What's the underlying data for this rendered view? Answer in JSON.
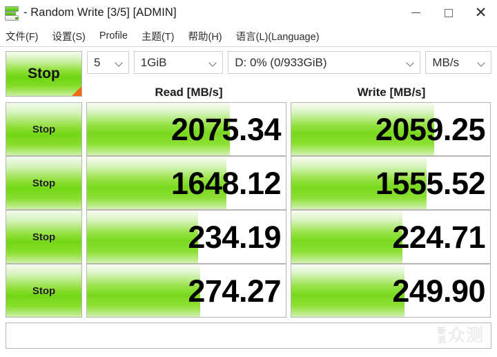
{
  "window": {
    "title": "- Random Write [3/5] [ADMIN]",
    "app_icon": "crystaldiskmark-icon",
    "minimize_label": "Minimize",
    "maximize_label": "Maximize",
    "close_label": "Close"
  },
  "menubar": {
    "items": [
      {
        "label": "文件(F)",
        "name": "menu-file"
      },
      {
        "label": "设置(S)",
        "name": "menu-settings"
      },
      {
        "label": "Profile",
        "name": "menu-profile"
      },
      {
        "label": "主题(T)",
        "name": "menu-theme"
      },
      {
        "label": "帮助(H)",
        "name": "menu-help"
      },
      {
        "label": "语言(L)(Language)",
        "name": "menu-language"
      }
    ]
  },
  "toolbar": {
    "all_button_label": "Stop",
    "test_count": "5",
    "test_size": "1GiB",
    "drive": "D: 0% (0/933GiB)",
    "unit": "MB/s"
  },
  "headers": {
    "read": "Read [MB/s]",
    "write": "Write [MB/s]"
  },
  "rows": [
    {
      "button_label": "Stop",
      "read": "2075.34",
      "write": "2059.25",
      "read_fill_pct": 72,
      "write_fill_pct": 72
    },
    {
      "button_label": "Stop",
      "read": "1648.12",
      "write": "1555.52",
      "read_fill_pct": 70,
      "write_fill_pct": 68
    },
    {
      "button_label": "Stop",
      "read": "234.19",
      "write": "224.71",
      "read_fill_pct": 56,
      "write_fill_pct": 56
    },
    {
      "button_label": "Stop",
      "read": "274.27",
      "write": "249.90",
      "read_fill_pct": 57,
      "write_fill_pct": 57
    }
  ],
  "statusbar": {
    "text": "",
    "watermark_small_top": "新",
    "watermark_small_bottom": "浪",
    "watermark_big": "众测"
  },
  "colors": {
    "bar_green": "#79d91e",
    "progress_orange": "#f26a14",
    "border_gray": "#b6b6b6"
  }
}
